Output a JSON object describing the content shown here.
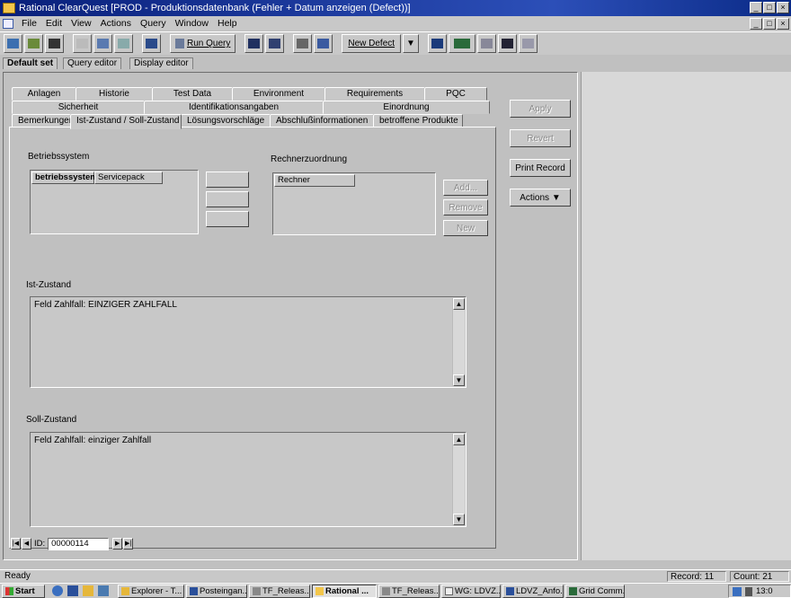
{
  "window": {
    "title": "Rational ClearQuest  [PROD - Produktionsdatenbank (Fehler + Datum anzeigen (Defect))]",
    "controls": [
      "_",
      "□",
      "×"
    ],
    "mdi_controls": [
      "_",
      "□",
      "×"
    ]
  },
  "menu": [
    "File",
    "Edit",
    "View",
    "Actions",
    "Query",
    "Window",
    "Help"
  ],
  "toolbar": {
    "run_query": "Run Query",
    "new_defect": "New Defect"
  },
  "view_tabs": [
    "Default set",
    "Query editor",
    "Display editor"
  ],
  "form_tabs": {
    "row1": [
      "Anlagen",
      "Historie",
      "Test Data",
      "Environment",
      "Requirements",
      "PQC"
    ],
    "row2": [
      "Sicherheit",
      "Identifikationsangaben",
      "Einordnung"
    ],
    "row3": [
      "Bemerkungen",
      "Ist-Zustand / Soll-Zustand",
      "Lösungsvorschläge",
      "Abschlußinformationen",
      "betroffene Produkte"
    ],
    "active": "Ist-Zustand / Soll-Zustand"
  },
  "betriebssystem": {
    "label": "Betriebssystem",
    "columns": [
      "betriebssystem",
      "Servicepack"
    ],
    "buttons": [
      "",
      "",
      ""
    ]
  },
  "rechner": {
    "label": "Rechnerzuordnung",
    "columns": [
      "Rechner"
    ],
    "buttons": [
      "Add...",
      "Remove",
      "New"
    ]
  },
  "ist_zustand": {
    "label": "Ist-Zustand",
    "text": "Feld Zahlfall: EINZIGER ZAHLFALL"
  },
  "soll_zustand": {
    "label": "Soll-Zustand",
    "text": "Feld Zahlfall: einziger Zahlfall"
  },
  "actions": {
    "apply": "Apply",
    "revert": "Revert",
    "print": "Print Record",
    "actions": "Actions ▼"
  },
  "record_nav": {
    "id_label": "ID:",
    "id_value": "00000114"
  },
  "status": {
    "left": "Ready",
    "record": "Record: 11",
    "count": "Count: 21"
  },
  "taskbar": {
    "start": "Start",
    "tasks": [
      "Explorer - T...",
      "Posteingan...",
      "TF_Releas...",
      "Rational ...",
      "TF_Releas...",
      "WG: LDVZ...",
      "LDVZ_Anfo...",
      "Grid Comm..."
    ],
    "clock": "13:0"
  }
}
